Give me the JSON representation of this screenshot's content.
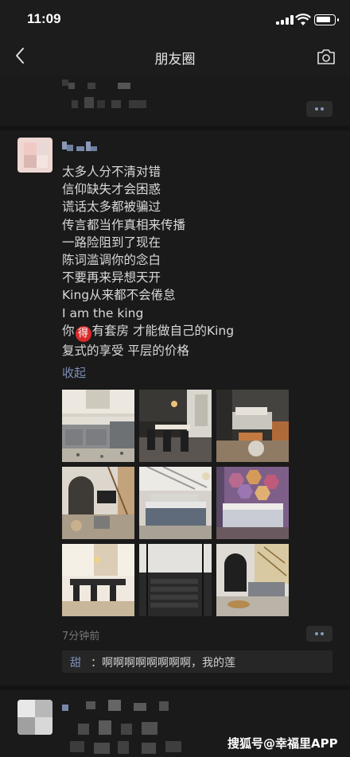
{
  "status_bar": {
    "time": "11:09"
  },
  "nav": {
    "title": "朋友圈"
  },
  "post": {
    "lines": [
      "太多人分不清对错",
      "信仰缺失才会困惑",
      "谎话太多都被骗过",
      "传言都当作真相来传播",
      "一路险阻到了现在",
      "陈词滥调你的念白",
      "不要再来异想天开",
      "King从来都不会倦怠",
      "I am the king"
    ],
    "line_10_before": "你",
    "line_10_badge": "得",
    "line_10_after": "有套房 才能做自己的King",
    "line_11": "复式的享受 平层的价格",
    "collapse_label": "收起",
    "photos": [
      "kitchen-photo",
      "dining-room-photo",
      "bedroom-photo",
      "loft-living-photo",
      "bedroom-photo-2",
      "hexagon-wall-bedroom-photo",
      "dining-table-photo",
      "stairs-photo",
      "living-room-photo"
    ],
    "timestamp": "7分钟前",
    "comment": {
      "author": "甜",
      "text": "：啊啊啊啊啊啊啊啊，我的莲"
    }
  },
  "watermark": "搜狐号@幸福里APP",
  "colors": {
    "background": "#1a1a1a",
    "link": "#7d90b8",
    "badge": "#d92a2a"
  }
}
